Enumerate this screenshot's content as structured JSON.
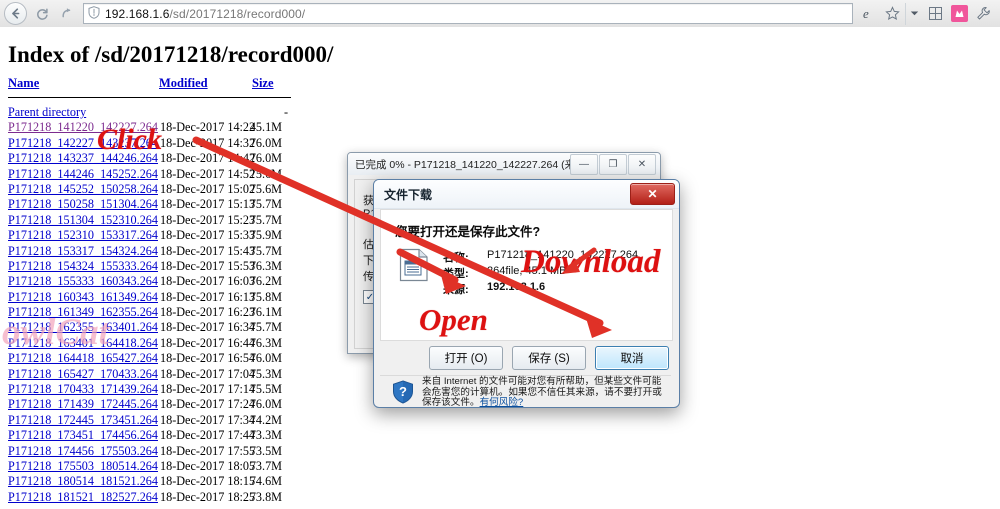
{
  "browser": {
    "url_value": "192.168.1.6/sd/20171218/record000/",
    "url_host": "192.168.1.6",
    "url_path": "/sd/20171218/record000/",
    "back_icon": "back-arrow-icon",
    "refresh_icon": "refresh-icon",
    "forward_icon": "forward-arrow-icon",
    "shield_icon": "shield-icon",
    "ie_icon": "internet-explorer-icon",
    "favorites_icon": "star-icon",
    "dropdown_icon": "chevron-down-icon",
    "grid_icon": "grid-icon",
    "pink_icon": "pink-app-icon",
    "tools_icon": "wrench-icon"
  },
  "page": {
    "title": "Index of /sd/20171218/record000/",
    "headers": {
      "name": "Name",
      "modified": "Modified",
      "size": "Size"
    },
    "parent": {
      "label": "Parent directory",
      "modified": "",
      "size": "-"
    },
    "rows": [
      {
        "name": "P171218_141220_142227.264",
        "modified": "18-Dec-2017 14:22",
        "size": "45.1M",
        "visited": true
      },
      {
        "name": "P171218_142227_143237.264",
        "modified": "18-Dec-2017 14:32",
        "size": "76.0M",
        "visited": false
      },
      {
        "name": "P171218_143237_144246.264",
        "modified": "18-Dec-2017 14:42",
        "size": "76.0M",
        "visited": false
      },
      {
        "name": "P171218_144246_145252.264",
        "modified": "18-Dec-2017 14:52",
        "size": "75.6M",
        "visited": false
      },
      {
        "name": "P171218_145252_150258.264",
        "modified": "18-Dec-2017 15:02",
        "size": "75.6M",
        "visited": false
      },
      {
        "name": "P171218_150258_151304.264",
        "modified": "18-Dec-2017 15:13",
        "size": "75.7M",
        "visited": false
      },
      {
        "name": "P171218_151304_152310.264",
        "modified": "18-Dec-2017 15:23",
        "size": "75.7M",
        "visited": false
      },
      {
        "name": "P171218_152310_153317.264",
        "modified": "18-Dec-2017 15:33",
        "size": "75.9M",
        "visited": false
      },
      {
        "name": "P171218_153317_154324.264",
        "modified": "18-Dec-2017 15:43",
        "size": "75.7M",
        "visited": false
      },
      {
        "name": "P171218_154324_155333.264",
        "modified": "18-Dec-2017 15:53",
        "size": "76.3M",
        "visited": false
      },
      {
        "name": "P171218_155333_160343.264",
        "modified": "18-Dec-2017 16:03",
        "size": "76.2M",
        "visited": false
      },
      {
        "name": "P171218_160343_161349.264",
        "modified": "18-Dec-2017 16:13",
        "size": "75.8M",
        "visited": false
      },
      {
        "name": "P171218_161349_162355.264",
        "modified": "18-Dec-2017 16:23",
        "size": "76.1M",
        "visited": false
      },
      {
        "name": "P171218_162355_163401.264",
        "modified": "18-Dec-2017 16:34",
        "size": "75.7M",
        "visited": false
      },
      {
        "name": "P171218_163401_164418.264",
        "modified": "18-Dec-2017 16:44",
        "size": "76.3M",
        "visited": false
      },
      {
        "name": "P171218_164418_165427.264",
        "modified": "18-Dec-2017 16:54",
        "size": "76.0M",
        "visited": false
      },
      {
        "name": "P171218_165427_170433.264",
        "modified": "18-Dec-2017 17:04",
        "size": "75.3M",
        "visited": false
      },
      {
        "name": "P171218_170433_171439.264",
        "modified": "18-Dec-2017 17:14",
        "size": "75.5M",
        "visited": false
      },
      {
        "name": "P171218_171439_172445.264",
        "modified": "18-Dec-2017 17:24",
        "size": "76.0M",
        "visited": false
      },
      {
        "name": "P171218_172445_173451.264",
        "modified": "18-Dec-2017 17:34",
        "size": "74.2M",
        "visited": false
      },
      {
        "name": "P171218_173451_174456.264",
        "modified": "18-Dec-2017 17:44",
        "size": "73.3M",
        "visited": false
      },
      {
        "name": "P171218_174456_175503.264",
        "modified": "18-Dec-2017 17:55",
        "size": "73.5M",
        "visited": false
      },
      {
        "name": "P171218_175503_180514.264",
        "modified": "18-Dec-2017 18:05",
        "size": "73.7M",
        "visited": false
      },
      {
        "name": "P171218_180514_181521.264",
        "modified": "18-Dec-2017 18:15",
        "size": "74.6M",
        "visited": false
      },
      {
        "name": "P171218_181521_182527.264",
        "modified": "18-Dec-2017 18:25",
        "size": "73.8M",
        "visited": false
      }
    ]
  },
  "progress_window": {
    "title": "已完成 0% - P171218_141220_142227.264 (来自 192....",
    "minimize_label": "—",
    "restore_label": "❐",
    "close_label": "✕",
    "line1": "获取",
    "line2": "P1",
    "line3": "估计",
    "line4": "下载",
    "line5": "传输",
    "checkbox_checked": "✓"
  },
  "dialog": {
    "title": "文件下载",
    "close_label": "✕",
    "question": "您要打开还是保存此文件?",
    "file_icon": "document-file-icon",
    "meta": [
      {
        "key": "名称:",
        "value": "P171218_141220_142227.264"
      },
      {
        "key": "类型:",
        "value": "264file, 45.1 MB"
      },
      {
        "key": "来源:",
        "value": "192.168.1.6"
      }
    ],
    "buttons": {
      "open": "打开 (O)",
      "save": "保存 (S)",
      "cancel": "取消"
    },
    "footer_icon": "shield-question-icon",
    "footer_text": "来自 Internet 的文件可能对您有所帮助，但某些文件可能会危害您的计算机。如果您不信任其来源，请不要打开或保存该文件。",
    "footer_link": "有何风险?"
  },
  "annotations": {
    "click": "Click",
    "download": "Download",
    "open": "Open",
    "arrow_color": "#e03127"
  },
  "watermark": {
    "text": "owlCat",
    "color": "#f3a7bd"
  }
}
